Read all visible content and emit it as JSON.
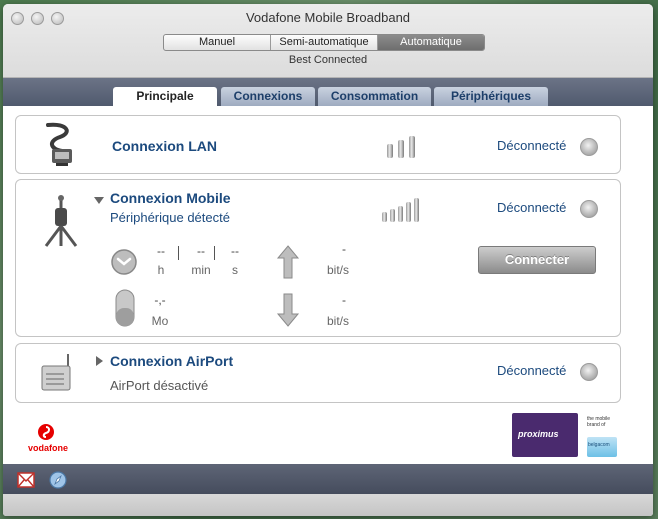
{
  "window": {
    "title": "Vodafone Mobile Broadband",
    "mode_options": [
      "Manuel",
      "Semi-automatique",
      "Automatique"
    ],
    "mode_selected": "Automatique",
    "mode_status": "Best Connected"
  },
  "tabs": [
    {
      "label": "Principale",
      "active": true
    },
    {
      "label": "Connexions",
      "active": false
    },
    {
      "label": "Consommation",
      "active": false
    },
    {
      "label": "Périphériques",
      "active": false
    }
  ],
  "lan": {
    "title": "Connexion LAN",
    "status": "Déconnecté",
    "icon": "ethernet-cable-icon",
    "signal_level": "3 bars"
  },
  "mobile": {
    "title": "Connexion Mobile",
    "subtitle": "Périphérique détecté",
    "status": "Déconnecté",
    "icon": "modem-antenna-icon",
    "signal_level": "5 bars",
    "duration": {
      "hours": "--",
      "minutes": "--",
      "seconds": "--",
      "unit_h": "h",
      "unit_min": "min",
      "unit_s": "s"
    },
    "upload": {
      "value": "-",
      "unit": "bit/s"
    },
    "download": {
      "value": "-",
      "unit": "bit/s"
    },
    "data_usage": {
      "value": "-,-",
      "unit": "Mo"
    },
    "connect_label": "Connecter"
  },
  "airport": {
    "title": "Connexion AirPort",
    "subtitle": "AirPort désactivé",
    "status": "Déconnecté",
    "icon": "airport-card-icon"
  },
  "branding": {
    "vodafone": "vodafone",
    "proximus": "proximus",
    "proximus_tagline": "the mobile brand of",
    "belgacom": "belgacom"
  },
  "colors": {
    "accent": "#1c4a7e",
    "tabbar": "#5a6378",
    "vodafone_red": "#e60000",
    "proximus_purple": "#4a2a6e"
  }
}
